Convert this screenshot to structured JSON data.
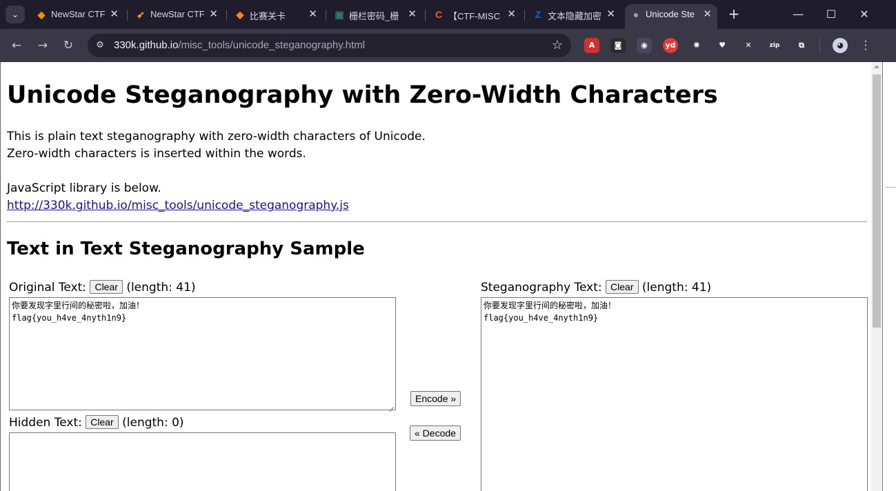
{
  "browser": {
    "tabs": [
      {
        "title": "NewStar CTF",
        "icon": "newstar-icon",
        "color": "#ff8a00",
        "glyph": "◆"
      },
      {
        "title": "NewStar CTF",
        "icon": "bird-icon",
        "color": "#f5a623",
        "glyph": "➶"
      },
      {
        "title": "比赛关卡",
        "icon": "newstar-icon",
        "color": "#ff8a00",
        "glyph": "◆"
      },
      {
        "title": "栅栏密码_栅",
        "icon": "doc-icon",
        "color": "#2e7d6b",
        "glyph": "▣"
      },
      {
        "title": "【CTF-MISC",
        "icon": "csdn-icon",
        "color": "#fc5531",
        "glyph": "C"
      },
      {
        "title": "文本隐藏加密",
        "icon": "zhihu-icon",
        "color": "#0066ff",
        "glyph": "Z"
      },
      {
        "title": "Unicode Ste",
        "icon": "globe-icon",
        "color": "#9aa0a6",
        "glyph": "●",
        "active": true
      }
    ],
    "new_tab": "+",
    "url_host": "330k.github.io",
    "url_path": "/misc_tools/unicode_steganography.html",
    "extensions": [
      {
        "name": "pdf-extension-icon",
        "color": "#d32f2f",
        "glyph": "A"
      },
      {
        "name": "reader-extension-icon",
        "color": "#2b2b2b",
        "glyph": "◙"
      },
      {
        "name": "owl-extension-icon",
        "color": "#4a4760",
        "glyph": "◉"
      },
      {
        "name": "youdao-extension-icon",
        "color": "#e53935",
        "glyph": "yd"
      },
      {
        "name": "sun-extension-icon",
        "color": "#3a3847",
        "glyph": "✺"
      },
      {
        "name": "heart-extension-icon",
        "color": "#3a3847",
        "glyph": "♥"
      },
      {
        "name": "x-extension-icon",
        "color": "#3a3847",
        "glyph": "✕"
      },
      {
        "name": "zip-extension-icon",
        "color": "#3a3847",
        "glyph": "zip"
      },
      {
        "name": "puzzle-extension-icon",
        "color": "#3a3847",
        "glyph": "⧉"
      }
    ]
  },
  "page": {
    "title": "Unicode Steganography with Zero-Width Characters",
    "intro_line1": "This is plain text steganography with zero-width characters of Unicode.",
    "intro_line2": "Zero-width characters is inserted within the words.",
    "lib_line": "JavaScript library is below.",
    "lib_link": "http://330k.github.io/misc_tools/unicode_steganography.js",
    "section_title": "Text in Text Steganography Sample",
    "original": {
      "label": "Original Text:",
      "clear": "Clear",
      "length": "(length: 41)",
      "value": "你要发现字里行间的秘密啦，加油！\nflag{you_h4ve_4nyth1n9}"
    },
    "hidden": {
      "label": "Hidden Text:",
      "clear": "Clear",
      "length": "(length: 0)",
      "value": ""
    },
    "stego": {
      "label": "Steganography Text:",
      "clear": "Clear",
      "length": "(length: 41)",
      "value": "你要发现字里行间的秘密啦，加油！\nflag{you_h4ve_4nyth1n9}"
    },
    "encode_label": "Encode »",
    "decode_label": "« Decode"
  }
}
